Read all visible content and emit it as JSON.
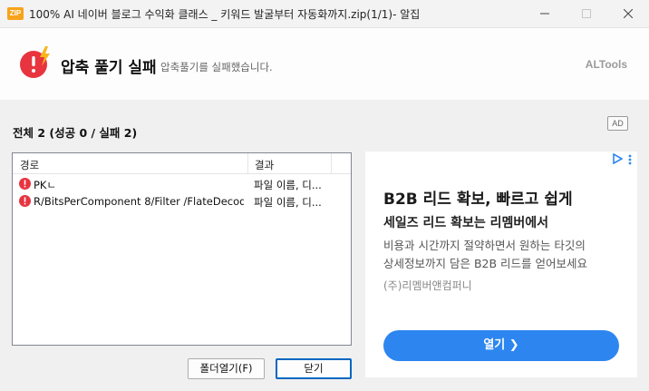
{
  "window": {
    "app_icon_text": "ZIP",
    "title": "100% AI 네이버 블로그 수익화 클래스 _ 키워드 발굴부터 자동화까지.zip(1/1)- 알집"
  },
  "header": {
    "title": "압축 풀기 실패",
    "subtitle": "압축풀기를 실패했습니다.",
    "brand": "ALTools"
  },
  "summary": "전체 2 (성공 0 / 실패 2)",
  "ad_badge": "AD",
  "list": {
    "columns": [
      "경로",
      "결과"
    ],
    "rows": [
      {
        "path": "PKㄴ",
        "result": "파일 이름, 디..."
      },
      {
        "path": "R/BitsPerComponent 8/Filter /FlateDecod...",
        "result": "파일 이름, 디..."
      }
    ]
  },
  "buttons": {
    "open_folder": "폴더열기(F)",
    "close": "닫기"
  },
  "ad": {
    "headline": "B2B 리드 확보, 빠르고 쉽게",
    "subheadline": "세일즈 리드 확보는 리멤버에서",
    "body_line1": "비용과 시간까지 절약하면서 원하는 타깃의",
    "body_line2": "상세정보까지 담은 B2B 리드를 얻어보세요",
    "advertiser": "(주)리멤버앤컴퍼니",
    "cta": "열기 ❯"
  },
  "colors": {
    "error_red": "#e8343f",
    "accent_yellow": "#f7b51b",
    "cta_blue": "#2d86f0",
    "focus_border": "#0067c0"
  },
  "icons": {
    "app": "zip-app-icon",
    "header": "error-lightning-icon",
    "row": "error-circle-icon",
    "ad_choices": "ad-choices-icon",
    "ad_menu": "more-vertical-icon"
  }
}
